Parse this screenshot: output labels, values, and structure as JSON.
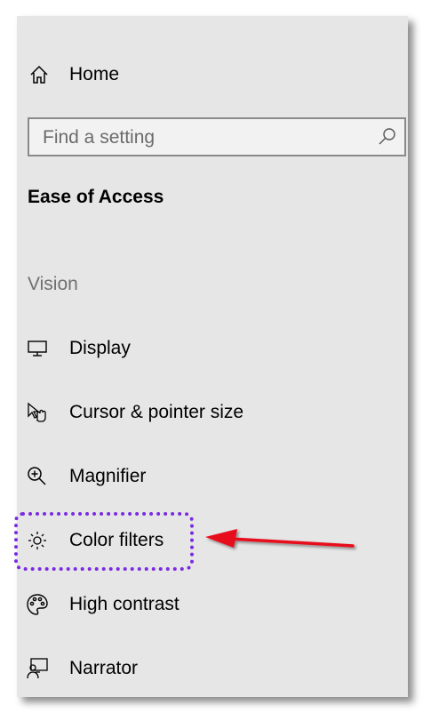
{
  "home": {
    "label": "Home",
    "icon": "home-icon"
  },
  "search": {
    "placeholder": "Find a setting",
    "value": "",
    "icon": "search-icon"
  },
  "section": {
    "title": "Ease of Access"
  },
  "vision": {
    "title": "Vision",
    "items": [
      {
        "label": "Display",
        "icon": "display-icon"
      },
      {
        "label": "Cursor & pointer size",
        "icon": "cursor-icon"
      },
      {
        "label": "Magnifier",
        "icon": "magnifier-icon"
      },
      {
        "label": "Color filters",
        "icon": "color-filters-icon"
      },
      {
        "label": "High contrast",
        "icon": "high-contrast-icon"
      },
      {
        "label": "Narrator",
        "icon": "narrator-icon"
      }
    ]
  },
  "annotation": {
    "highlight_color": "#7a2be2",
    "arrow_color": "#e8101a"
  }
}
